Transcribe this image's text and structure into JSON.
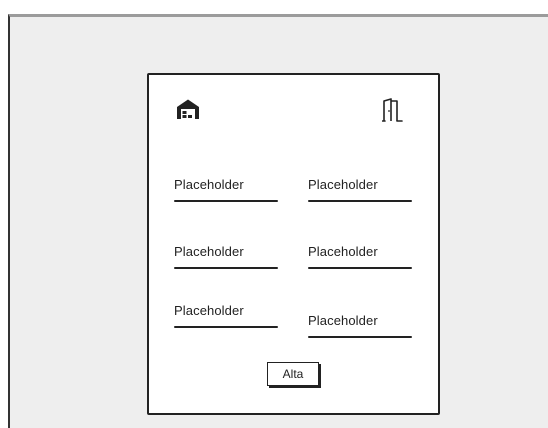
{
  "form": {
    "fields": [
      {
        "placeholder": "Placeholder"
      },
      {
        "placeholder": "Placeholder"
      },
      {
        "placeholder": "Placeholder"
      },
      {
        "placeholder": "Placeholder"
      },
      {
        "placeholder": "Placeholder"
      },
      {
        "placeholder": "Placeholder"
      }
    ],
    "submit_label": "Alta"
  },
  "icons": {
    "top_left": "warehouse-icon",
    "top_right": "exit-door-icon"
  },
  "colors": {
    "canvas_background": "#eeeeee",
    "card_background": "#ffffff",
    "ink": "#222222"
  }
}
